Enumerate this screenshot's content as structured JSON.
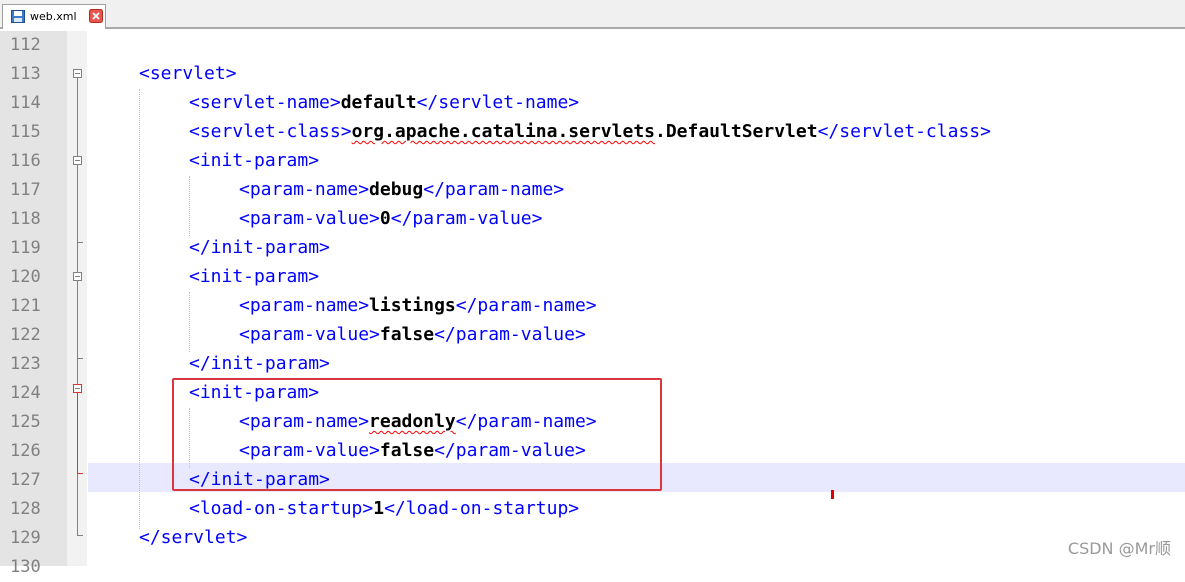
{
  "tab": {
    "label": "web.xml"
  },
  "watermark": "CSDN @Mr顺",
  "lines": [
    {
      "num": "112",
      "indent": 0,
      "parts": []
    },
    {
      "num": "113",
      "indent": 1,
      "parts": [
        {
          "t": "tag",
          "s": "<servlet>"
        }
      ]
    },
    {
      "num": "114",
      "indent": 2,
      "parts": [
        {
          "t": "tag",
          "s": "<servlet-name>"
        },
        {
          "t": "val",
          "s": "default"
        },
        {
          "t": "tag",
          "s": "</servlet-name>"
        }
      ]
    },
    {
      "num": "115",
      "indent": 2,
      "parts": [
        {
          "t": "tag",
          "s": "<servlet-class>"
        },
        {
          "t": "valsq",
          "s": "org.apache.catalina.servlets"
        },
        {
          "t": "val",
          "s": ".DefaultServlet"
        },
        {
          "t": "tag",
          "s": "</servlet-class>"
        }
      ]
    },
    {
      "num": "116",
      "indent": 2,
      "parts": [
        {
          "t": "tag",
          "s": "<init-param>"
        }
      ]
    },
    {
      "num": "117",
      "indent": 3,
      "parts": [
        {
          "t": "tag",
          "s": "<param-name>"
        },
        {
          "t": "val",
          "s": "debug"
        },
        {
          "t": "tag",
          "s": "</param-name>"
        }
      ]
    },
    {
      "num": "118",
      "indent": 3,
      "parts": [
        {
          "t": "tag",
          "s": "<param-value>"
        },
        {
          "t": "val",
          "s": "0"
        },
        {
          "t": "tag",
          "s": "</param-value>"
        }
      ]
    },
    {
      "num": "119",
      "indent": 2,
      "parts": [
        {
          "t": "tag",
          "s": "</init-param>"
        }
      ]
    },
    {
      "num": "120",
      "indent": 2,
      "parts": [
        {
          "t": "tag",
          "s": "<init-param>"
        }
      ]
    },
    {
      "num": "121",
      "indent": 3,
      "parts": [
        {
          "t": "tag",
          "s": "<param-name>"
        },
        {
          "t": "val",
          "s": "listings"
        },
        {
          "t": "tag",
          "s": "</param-name>"
        }
      ]
    },
    {
      "num": "122",
      "indent": 3,
      "parts": [
        {
          "t": "tag",
          "s": "<param-value>"
        },
        {
          "t": "val",
          "s": "false"
        },
        {
          "t": "tag",
          "s": "</param-value>"
        }
      ]
    },
    {
      "num": "123",
      "indent": 2,
      "parts": [
        {
          "t": "tag",
          "s": "</init-param>"
        }
      ]
    },
    {
      "num": "124",
      "indent": 2,
      "parts": [
        {
          "t": "tag",
          "s": "<init-param>"
        }
      ]
    },
    {
      "num": "125",
      "indent": 3,
      "parts": [
        {
          "t": "tag",
          "s": "<param-name>"
        },
        {
          "t": "valsq",
          "s": "readonly"
        },
        {
          "t": "tag",
          "s": "</param-name>"
        }
      ]
    },
    {
      "num": "126",
      "indent": 3,
      "parts": [
        {
          "t": "tag",
          "s": "<param-value>"
        },
        {
          "t": "val",
          "s": "false"
        },
        {
          "t": "tag",
          "s": "</param-value>"
        }
      ]
    },
    {
      "num": "127",
      "indent": 2,
      "parts": [
        {
          "t": "tag",
          "s": "</init-param>"
        }
      ]
    },
    {
      "num": "128",
      "indent": 2,
      "parts": [
        {
          "t": "tag",
          "s": "<load-on-startup>"
        },
        {
          "t": "val",
          "s": "1"
        },
        {
          "t": "tag",
          "s": "</load-on-startup>"
        }
      ]
    },
    {
      "num": "129",
      "indent": 1,
      "parts": [
        {
          "t": "tag",
          "s": "</servlet>"
        }
      ]
    },
    {
      "num": "130",
      "indent": 0,
      "parts": []
    }
  ],
  "colors": {
    "tag": "#0000ff",
    "value": "#000000",
    "highlight_box": "#d9363e",
    "current_line": "#e8e8ff"
  }
}
